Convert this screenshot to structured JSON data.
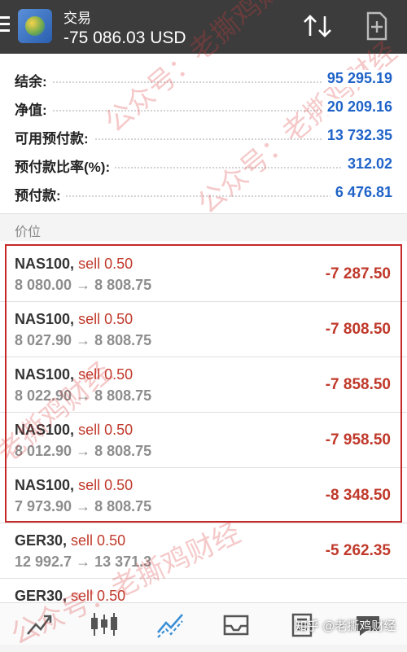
{
  "header": {
    "title": "交易",
    "balance_line": "-75 086.03 USD"
  },
  "summary": {
    "rows": [
      {
        "label": "结余:",
        "value": "95 295.19"
      },
      {
        "label": "净值:",
        "value": "20 209.16"
      },
      {
        "label": "可用预付款:",
        "value": "13 732.35"
      },
      {
        "label": "预付款比率(%):",
        "value": "312.02"
      },
      {
        "label": "预付款:",
        "value": "6 476.81"
      }
    ]
  },
  "section": {
    "label": "价位"
  },
  "positions": [
    {
      "symbol": "NAS100,",
      "side": "sell 0.50",
      "prices": "8 080.00 → 8 808.75",
      "profit": "-7 287.50"
    },
    {
      "symbol": "NAS100,",
      "side": "sell 0.50",
      "prices": "8 027.90 → 8 808.75",
      "profit": "-7 808.50"
    },
    {
      "symbol": "NAS100,",
      "side": "sell 0.50",
      "prices": "8 022.90 → 8 808.75",
      "profit": "-7 858.50"
    },
    {
      "symbol": "NAS100,",
      "side": "sell 0.50",
      "prices": "8 012.90 → 8 808.75",
      "profit": "-7 958.50"
    },
    {
      "symbol": "NAS100,",
      "side": "sell 0.50",
      "prices": "7 973.90 → 8 808.75",
      "profit": "-8 348.50"
    },
    {
      "symbol": "GER30,",
      "side": "sell 0.50",
      "prices": "12 992.7 → 13 371.3",
      "profit": "-5 262.35"
    },
    {
      "symbol": "GER30,",
      "side": "sell 0.50",
      "prices": "",
      "profit": ""
    }
  ],
  "watermarks": {
    "wm1": "公众号：老撕鸡财经",
    "wm2": "公众号：老撕鸡财经",
    "wm3": "老撕鸡财经",
    "wm4": "公众号：老撕鸡财经",
    "zhihu": "知乎 @老撕鸡财经"
  },
  "colors": {
    "accent_blue": "#1f63c8",
    "loss_red": "#c0392b",
    "topbar": "#3c3c3c"
  },
  "icons": [
    "menu-icon",
    "app-logo",
    "sort-icon",
    "add-document-icon",
    "chart-trend-icon",
    "candlestick-icon",
    "trade-icon",
    "inbox-icon",
    "journal-icon",
    "chat-icon"
  ]
}
